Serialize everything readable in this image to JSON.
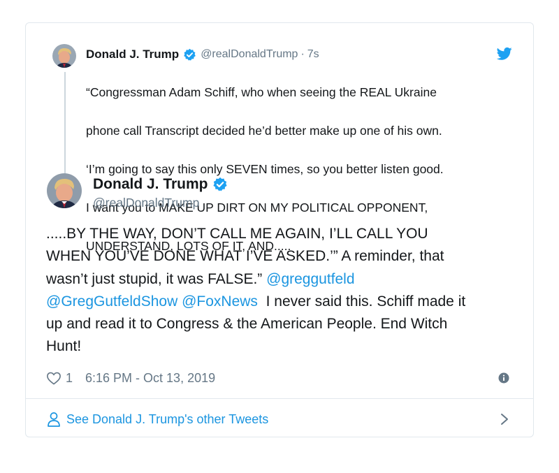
{
  "parent_tweet": {
    "author_name": "Donald J. Trump",
    "handle": "@realDonaldTrump",
    "separator": "·",
    "time": "7s",
    "lines": [
      "“Congressman Adam Schiff, who when seeing the REAL Ukraine",
      "phone call Transcript decided he’d better make up one of his own.",
      "‘I’m going to say this only SEVEN times, so you better listen good.",
      "I want you to MAKE UP DIRT ON MY POLITICAL OPPONENT,",
      "UNDERSTAND, LOTS OF IT, AND....."
    ]
  },
  "main_tweet": {
    "author_name": "Donald J. Trump",
    "handle": "@realDonaldTrump",
    "line1": ".....BY THE WAY, DON’T CALL ME AGAIN, I’LL CALL YOU",
    "line2": "WHEN YOU’VE DONE WHAT I’VE ASKED.’” A reminder, that",
    "line3_text": "wasn’t just stupid, it was FALSE.” ",
    "mention_1": "@greggutfeld",
    "mention_2": "@GregGutfeldShow",
    "mention_3": "@FoxNews",
    "line4_text": "  I never said this. Schiff made it",
    "line5": "up and read it to Congress & the American People. End Witch",
    "line6": "Hunt!",
    "like_count": "1",
    "timestamp": "6:16 PM - Oct 13, 2019"
  },
  "footer": {
    "link_label": "See Donald J. Trump's other Tweets"
  },
  "icons": {
    "verified": "verified-badge-icon",
    "bird": "twitter-bird-icon",
    "heart": "heart-icon",
    "info": "info-icon",
    "person": "person-icon",
    "chevron": "chevron-right-icon"
  },
  "colors": {
    "link": "#1b95e0",
    "muted": "#657786",
    "border": "#e1e8ed"
  }
}
